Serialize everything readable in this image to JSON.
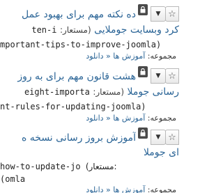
{
  "articles": [
    {
      "title_line1": "ده نکته مهم برای بهبود عمل",
      "title_line2": "کرد وبسایت جوملایی",
      "alias_label": "(مستعار:",
      "alias_part1": "ten-i",
      "alias_part2": "mportant-tips-to-improve-joomla)",
      "category_label": "مجموعه:",
      "category_path": "آموزش ها « دانلود"
    },
    {
      "title_line1": "هشت قانون مهم برای به روز",
      "title_line2": "رسانی جوملا",
      "alias_label": "(مستعار:",
      "alias_part1": "eight-importa",
      "alias_part2": "nt-rules-for-updating-joomla)",
      "category_label": "مجموعه:",
      "category_path": "آموزش ها « دانلود"
    },
    {
      "title_line1": "آموزش بروز رسانی نسخه ه",
      "title_line2": "ای جوملا",
      "alias_label": "(مستعار:",
      "alias_part1": "how-to-update-jo",
      "alias_part2": "omla)",
      "category_label": "مجموعه:",
      "category_path": "آموزش ها « دانلود"
    }
  ],
  "icons": {
    "star": "star-icon",
    "caret": "caret-down-icon",
    "lock": "lock-icon"
  },
  "colors": {
    "link": "#2a6496",
    "lock_bg": "#4a4a4a"
  }
}
